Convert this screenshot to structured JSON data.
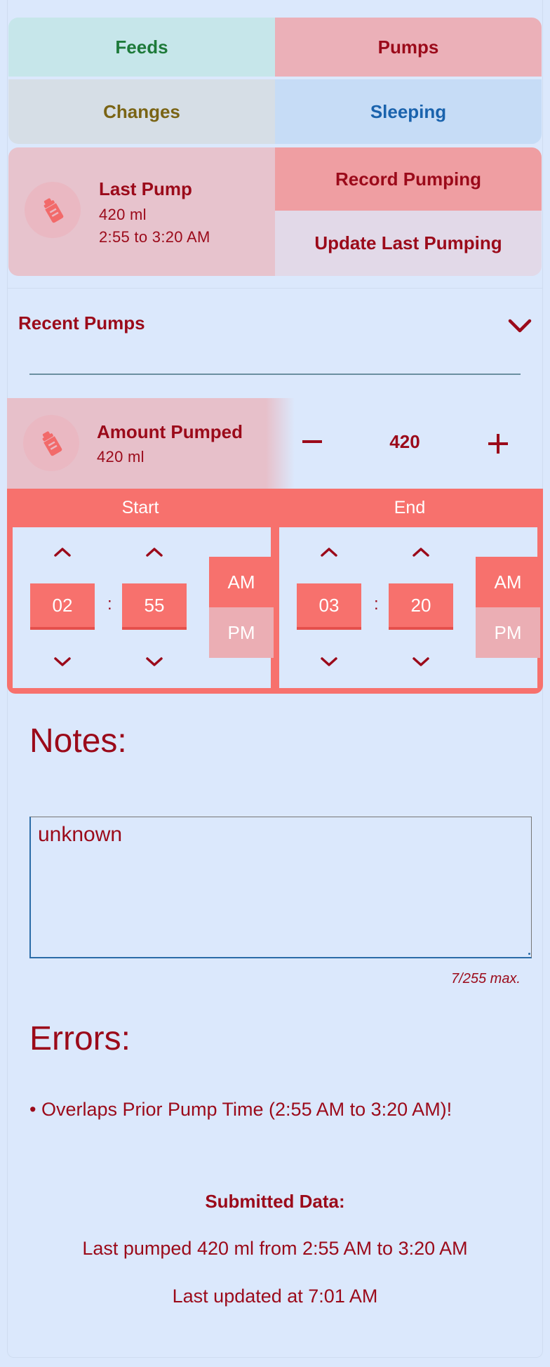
{
  "nav": {
    "feeds": "Feeds",
    "pumps": "Pumps",
    "changes": "Changes",
    "sleeping": "Sleeping"
  },
  "last_pump": {
    "title": "Last Pump",
    "amount": "420 ml",
    "time_range": "2:55 to 3:20 AM",
    "icon": "bottle-icon"
  },
  "actions": {
    "record": "Record Pumping",
    "update": "Update Last Pumping"
  },
  "recent": {
    "label": "Recent Pumps",
    "icon": "chevron-down-icon"
  },
  "amount": {
    "title": "Amount Pumped",
    "value_text": "420 ml",
    "stepper_value": "420",
    "minus_icon": "minus-icon",
    "plus_icon": "plus-icon"
  },
  "time": {
    "start": {
      "label": "Start",
      "hour": "02",
      "minute": "55",
      "am": "AM",
      "pm": "PM",
      "selected": "AM"
    },
    "end": {
      "label": "End",
      "hour": "03",
      "minute": "20",
      "am": "AM",
      "pm": "PM",
      "selected": "AM"
    },
    "separator": ":"
  },
  "notes": {
    "title": "Notes:",
    "value": "unknown",
    "counter": "7/255 max."
  },
  "errors": {
    "title": "Errors:",
    "items": [
      "• Overlaps Prior Pump Time (2:55 AM to 3:20 AM)!"
    ]
  },
  "submitted": {
    "title": "Submitted Data:",
    "line1": "Last pumped 420 ml from 2:55 AM to 3:20 AM",
    "line2": "Last updated at 7:01 AM"
  },
  "colors": {
    "background": "#dbe8fc",
    "accent": "#f7716d",
    "text": "#9b0a1a",
    "feeds": "#c6e6ea",
    "pumps": "#ebb0b8",
    "changes": "#d6dee6",
    "sleeping": "#c6dcf6"
  }
}
